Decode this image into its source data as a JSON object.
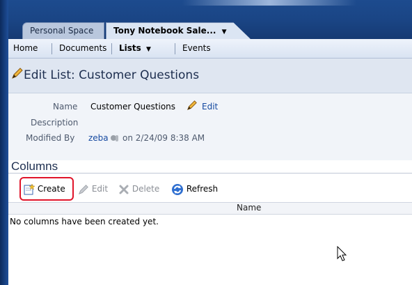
{
  "tabs": [
    {
      "label": "Personal Space"
    },
    {
      "label": "Tony Notebook Sale...",
      "caret": "▼"
    }
  ],
  "nav": {
    "items": [
      {
        "label": "Home"
      },
      {
        "label": "Documents"
      },
      {
        "label": "Lists",
        "caret": "▼"
      },
      {
        "label": "Events"
      }
    ]
  },
  "page": {
    "title": "Edit List: Customer Questions"
  },
  "details": {
    "name_label": "Name",
    "name_value": "Customer Questions",
    "edit_link": "Edit",
    "description_label": "Description",
    "modified_label": "Modified By",
    "modified_user": "zeba",
    "modified_date": "on 2/24/09 8:38 AM"
  },
  "columns": {
    "heading": "Columns",
    "toolbar": {
      "create": "Create",
      "edit": "Edit",
      "delete": "Delete",
      "refresh": "Refresh"
    },
    "table_header": "Name",
    "empty_message": "No columns have been created yet."
  },
  "colors": {
    "accent_blue": "#1d4b8e",
    "link": "#1549a0",
    "highlight": "#e0142a"
  },
  "icons": [
    "pencil-icon",
    "presence-icon",
    "create-icon",
    "edit-icon",
    "delete-icon",
    "refresh-icon",
    "mouse-cursor-icon"
  ]
}
